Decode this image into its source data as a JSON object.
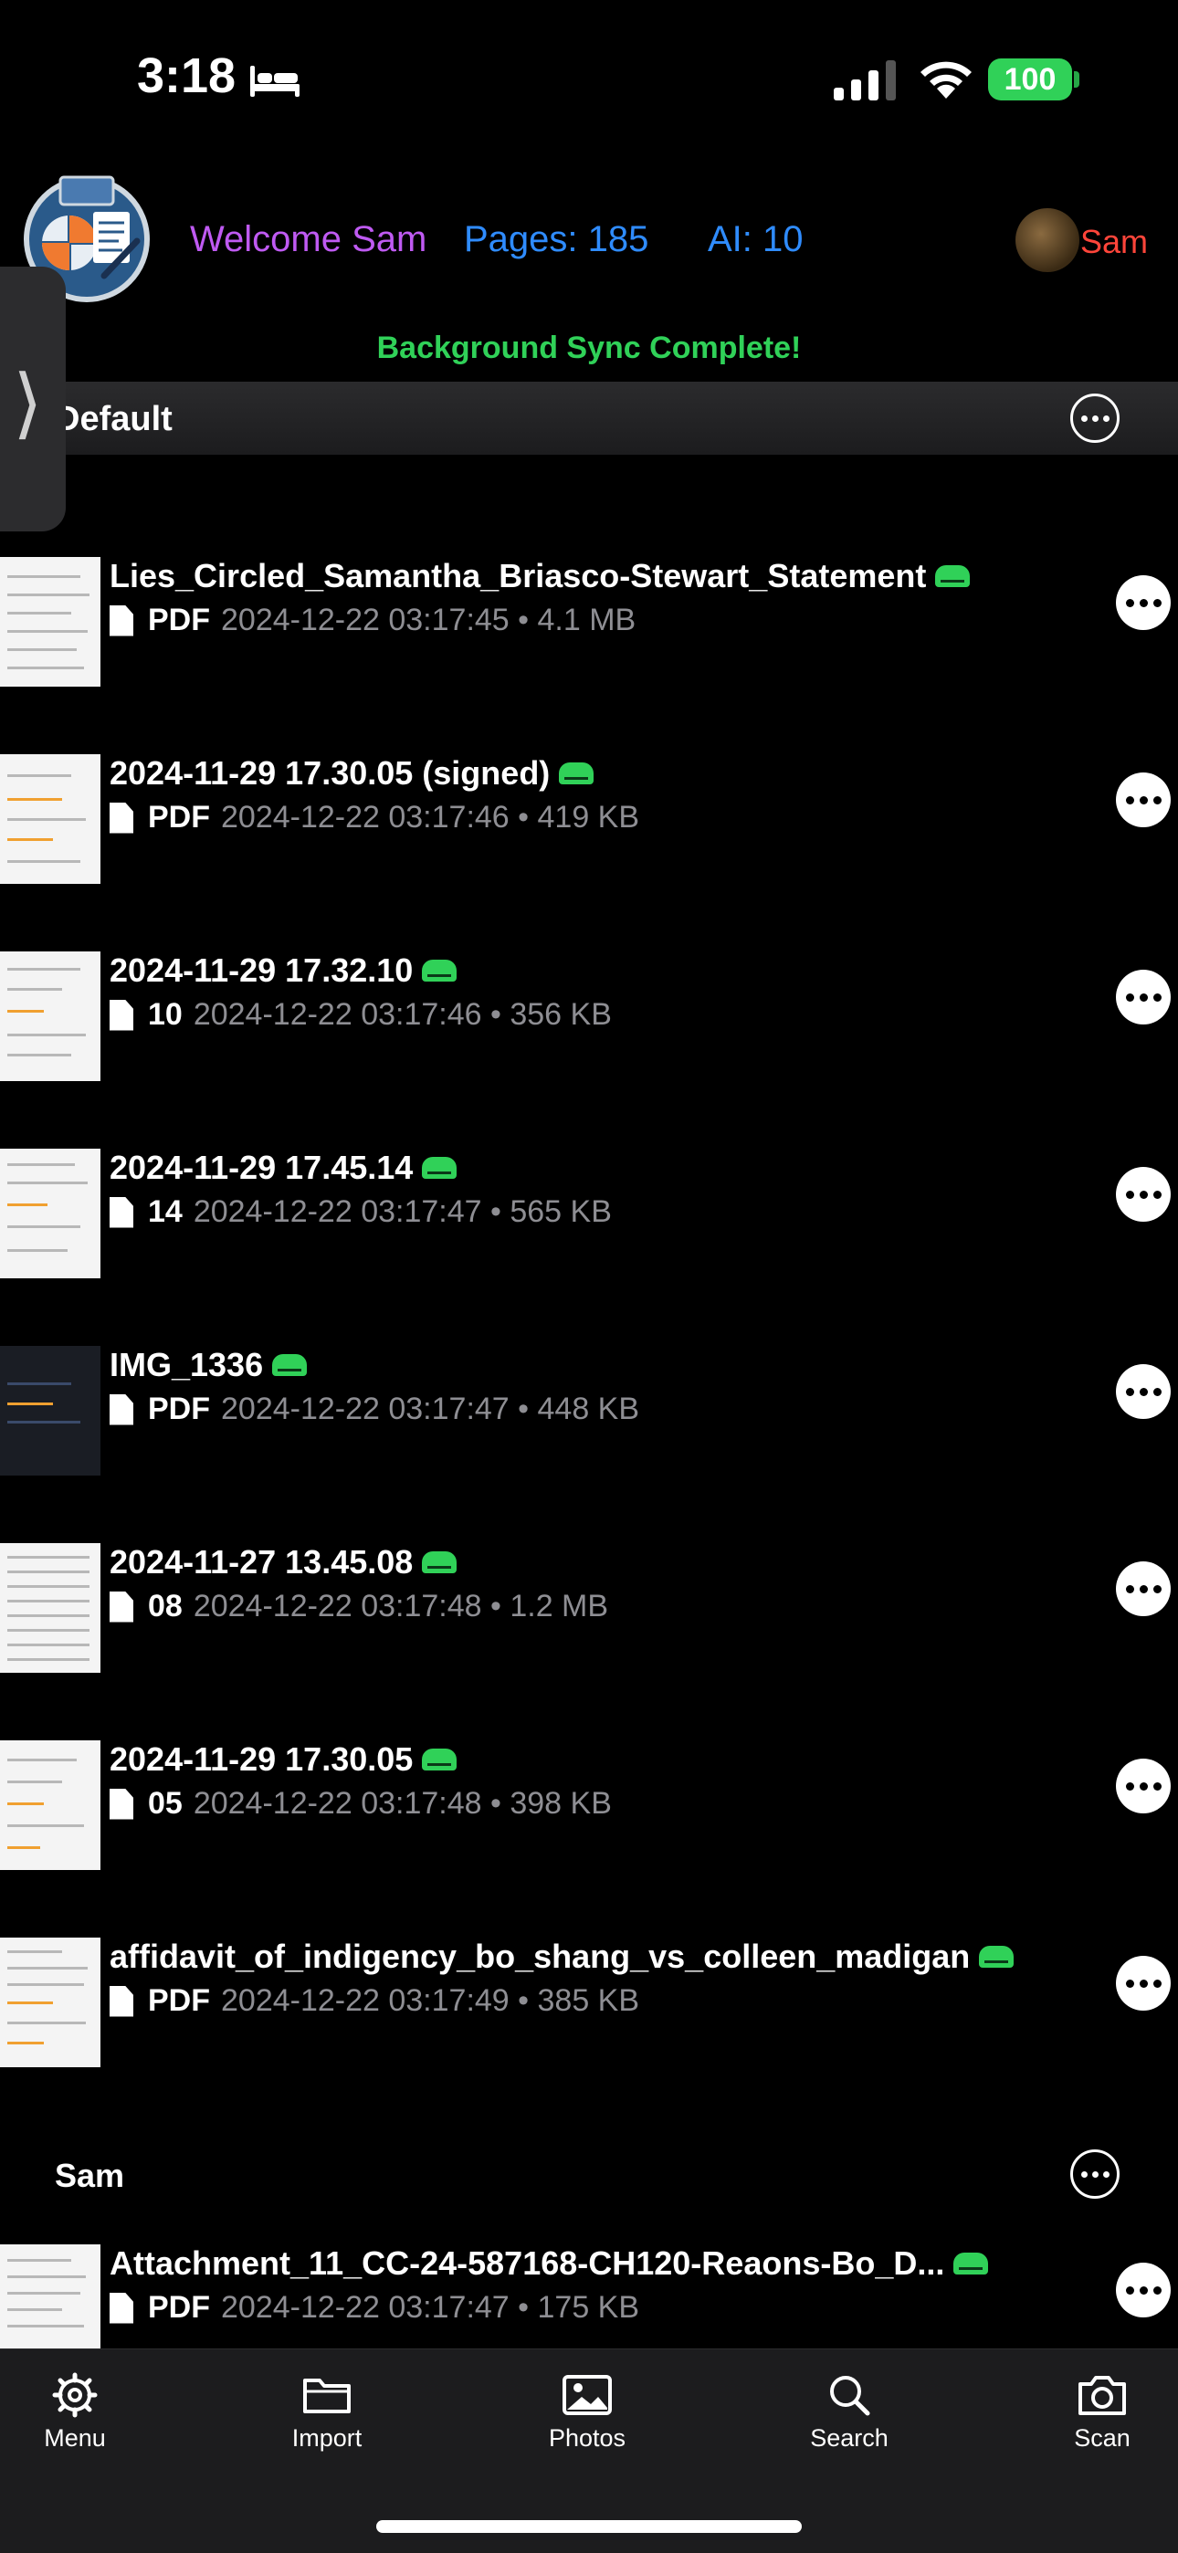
{
  "status_bar": {
    "time": "3:18",
    "battery": "100"
  },
  "header": {
    "welcome": "Welcome Sam",
    "pages": "Pages: 185",
    "ai": "AI: 10",
    "user_name": "Sam",
    "sync_message": "Background Sync Complete!"
  },
  "drawer_toggle": "⟩",
  "sections": [
    {
      "title": "Default",
      "files": [
        {
          "name": "Lies_Circled_Samantha_Briasco-Stewart_Statement",
          "type": "PDF",
          "date": "2024-12-22 03:17:45 • 4.1 MB"
        },
        {
          "name": "2024-11-29 17.30.05 (signed)",
          "type": "PDF",
          "date": "2024-12-22 03:17:46 • 419 KB"
        },
        {
          "name": "2024-11-29 17.32.10",
          "type": "10",
          "date": "2024-12-22 03:17:46 • 356 KB"
        },
        {
          "name": "2024-11-29 17.45.14",
          "type": "14",
          "date": "2024-12-22 03:17:47 • 565 KB"
        },
        {
          "name": "IMG_1336",
          "type": "PDF",
          "date": "2024-12-22 03:17:47 • 448 KB"
        },
        {
          "name": "2024-11-27 13.45.08",
          "type": "08",
          "date": "2024-12-22 03:17:48 • 1.2 MB"
        },
        {
          "name": "2024-11-29 17.30.05",
          "type": "05",
          "date": "2024-12-22 03:17:48 • 398 KB"
        },
        {
          "name": "affidavit_of_indigency_bo_shang_vs_colleen_madigan",
          "type": "PDF",
          "date": "2024-12-22 03:17:49 • 385 KB"
        }
      ]
    },
    {
      "title": "Sam",
      "files": [
        {
          "name": "Attachment_11_CC-24-587168-CH120-Reaons-Bo_D...",
          "type": "PDF",
          "date": "2024-12-22 03:17:47 • 175 KB"
        }
      ]
    }
  ],
  "tab_bar": {
    "menu": "Menu",
    "import": "Import",
    "photos": "Photos",
    "search": "Search",
    "scan": "Scan"
  },
  "colors": {
    "welcome": "#bf5af2",
    "stats": "#2f8cff",
    "user_name": "#ff453a",
    "sync": "#30d158",
    "cloud_badge": "#30d158"
  }
}
